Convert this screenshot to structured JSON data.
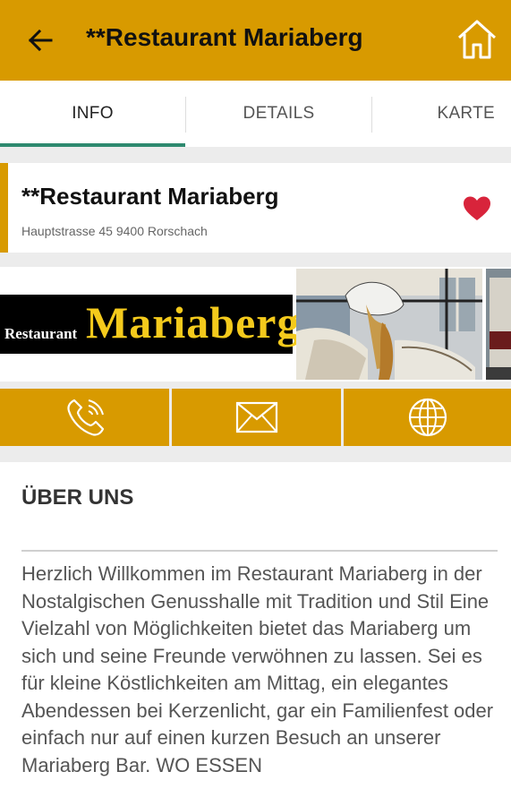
{
  "header": {
    "title": "**Restaurant Mariaberg",
    "back_icon": "arrow-left-icon",
    "home_icon": "home-icon",
    "color": "#d89a00"
  },
  "tabs": [
    {
      "label": "INFO",
      "active": true
    },
    {
      "label": "DETAILS",
      "active": false
    },
    {
      "label": "KARTE",
      "active": false
    }
  ],
  "place": {
    "name": "**Restaurant Mariaberg",
    "address": "Hauptstrasse 45 9400 Rorschach",
    "favorite": true,
    "favorite_icon": "heart-icon",
    "favorite_color": "#d8243b"
  },
  "gallery": {
    "logo_small": "Restaurant",
    "logo_big": "Mariaberg"
  },
  "actions": [
    {
      "icon": "phone-icon"
    },
    {
      "icon": "mail-icon"
    },
    {
      "icon": "globe-icon"
    }
  ],
  "about": {
    "heading": "ÜBER UNS",
    "text": "Herzlich Willkommen im Restaurant Mariaberg in der Nostalgischen Genusshalle mit Tradition und Stil Eine Vielzahl von Möglichkeiten bietet das Mariaberg um sich und seine Freunde verwöhnen zu lassen. Sei es für kleine Köstlichkeiten am Mittag, ein elegantes Abendessen bei Kerzenlicht, gar ein Familienfest oder einfach nur auf einen kurzen Besuch an unserer Mariaberg Bar. WO ESSEN"
  }
}
